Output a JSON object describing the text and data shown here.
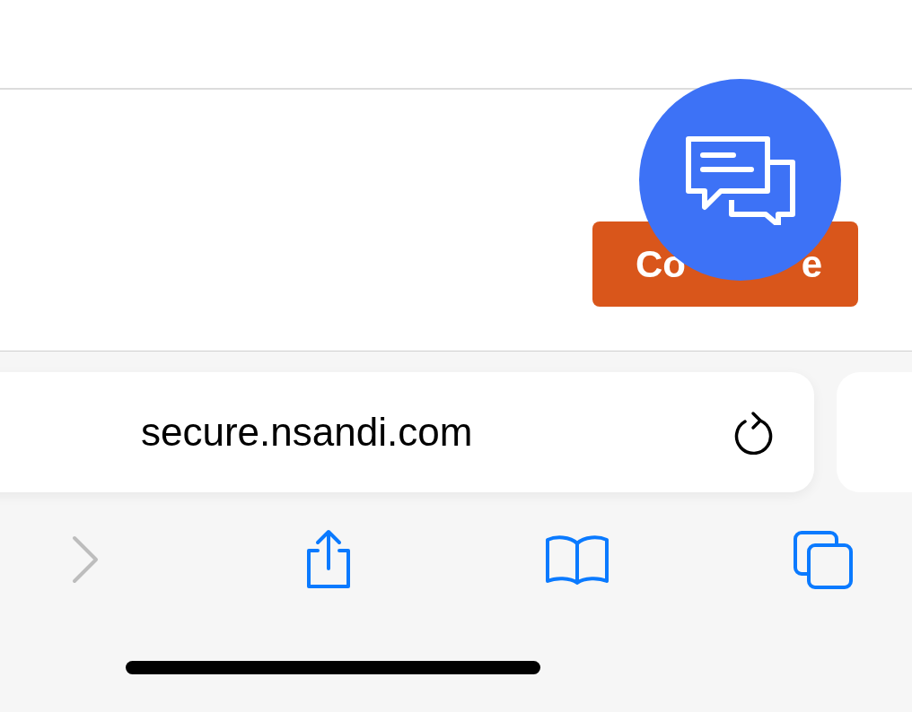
{
  "page": {
    "continue_button": {
      "label_parts": [
        "Co",
        "e"
      ]
    }
  },
  "address_bar": {
    "url": "secure.nsandi.com"
  },
  "toolbar": {
    "forward_disabled": true
  }
}
